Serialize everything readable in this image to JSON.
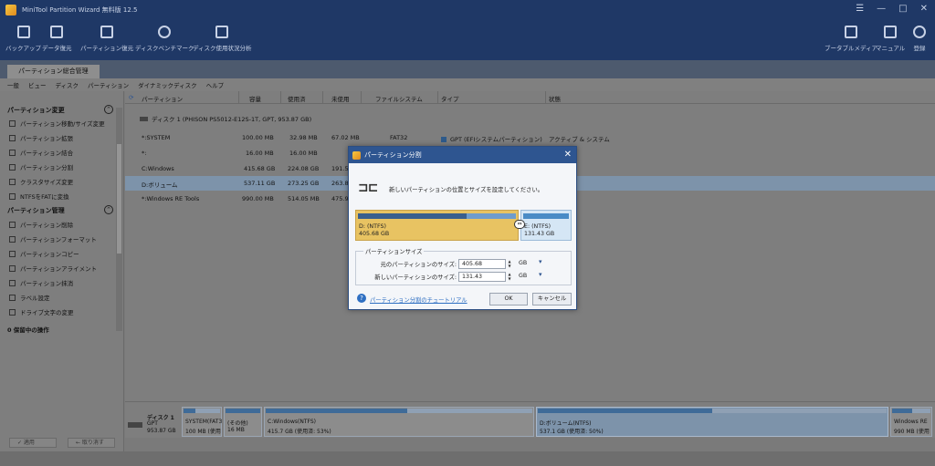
{
  "app": {
    "title": "MiniTool Partition Wizard 無料版 12.5",
    "window_controls": [
      "☰",
      "—",
      "□",
      "✕"
    ]
  },
  "toolbar": {
    "items": [
      {
        "label": "バックアップ",
        "icon": "backup-icon"
      },
      {
        "label": "データ復元",
        "icon": "data-recovery-icon"
      },
      {
        "label": "パーティション復元",
        "icon": "partition-recovery-icon"
      },
      {
        "label": "ディスクベンチマーク",
        "icon": "disk-benchmark-icon"
      },
      {
        "label": "ディスク使用状況分析",
        "icon": "space-analyzer-icon"
      }
    ],
    "right_items": [
      {
        "label": "ブータブルメディア",
        "icon": "bootable-media-icon"
      },
      {
        "label": "マニュアル",
        "icon": "manual-icon"
      },
      {
        "label": "登録",
        "icon": "register-icon"
      }
    ]
  },
  "tabs": [
    {
      "label": "パーティション総合管理"
    }
  ],
  "menu": [
    "一般",
    "ビュー",
    "ディスク",
    "パーティション",
    "ダイナミックディスク",
    "ヘルプ"
  ],
  "left_panel": {
    "section1": {
      "title": "パーティション変更",
      "items": [
        "パーティション移動/サイズ変更",
        "パーティション拡張",
        "パーティション結合",
        "パーティション分割",
        "クラスタサイズ変更",
        "NTFSをFATに変換"
      ]
    },
    "section2": {
      "title": "パーティション管理",
      "items": [
        "パーティション削除",
        "パーティションフォーマット",
        "パーティションコピー",
        "パーティションアライメント",
        "パーティション抹消",
        "ラベル設定",
        "ドライブ文字の変更"
      ]
    },
    "pending": "0 保留中の操作",
    "apply": "✓ 適用",
    "undo": "← 取り消す"
  },
  "table": {
    "headers": [
      "パーティション",
      "容量",
      "使用済",
      "未使用",
      "ファイルシステム",
      "タイプ",
      "状態"
    ],
    "disk_label": "ディスク 1 (PHISON PS5012-E12S-1T, GPT, 953.87 GB)",
    "rows": [
      {
        "name": "*:SYSTEM",
        "capacity": "100.00 MB",
        "used": "32.98 MB",
        "unused": "67.02 MB",
        "fs": "FAT32",
        "type": "GPT (EFIシステムパーティション)",
        "status": "アクティブ & システム"
      },
      {
        "name": "*:",
        "capacity": "16.00 MB",
        "used": "16.00 MB",
        "unused": "",
        "fs": "",
        "type": "",
        "status": ""
      },
      {
        "name": "C:Windows",
        "capacity": "415.68 GB",
        "used": "224.08 GB",
        "unused": "191.5",
        "fs": "",
        "type": "",
        "status": ""
      },
      {
        "name": "D:ボリューム",
        "capacity": "537.11 GB",
        "used": "273.25 GB",
        "unused": "263.8",
        "fs": "",
        "type": "",
        "status": ""
      },
      {
        "name": "*:Windows RE Tools",
        "capacity": "990.00 MB",
        "used": "514.05 MB",
        "unused": "475.9",
        "fs": "",
        "type": "",
        "status": ""
      }
    ]
  },
  "diskmap": {
    "disk_title": "ディスク 1",
    "disk_type": "GPT",
    "disk_size": "953.87 GB",
    "segments": [
      {
        "l1": "SYSTEM(FAT3",
        "l2": "100 MB (使用",
        "used": 0.33
      },
      {
        "l1": "(その他)",
        "l2": "16 MB",
        "used": 1.0
      },
      {
        "l1": "C:Windows(NTFS)",
        "l2": "415.7 GB (使用済: 53%)",
        "used": 0.53
      },
      {
        "l1": "D:ボリューム(NTFS)",
        "l2": "537.1 GB (使用済: 50%)",
        "used": 0.5
      },
      {
        "l1": "Windows RE",
        "l2": "990 MB (使用",
        "used": 0.52
      }
    ]
  },
  "dialog": {
    "title": "パーティション分割",
    "description": "新しいパーティションの位置とサイズを設定してください。",
    "part_a": {
      "name": "D: (NTFS)",
      "size": "405.68 GB",
      "used": 0.69
    },
    "part_b": {
      "name": "E: (NTFS)",
      "size": "131.43 GB"
    },
    "group_title": "パーティションサイズ",
    "orig_label": "元のパーティションのサイズ:",
    "orig_value": "405.68",
    "new_label": "新しいパーティションのサイズ:",
    "new_value": "131.43",
    "unit": "GB",
    "help_link": "パーティション分割のチュートリアル",
    "ok": "OK",
    "cancel": "キャンセル"
  }
}
